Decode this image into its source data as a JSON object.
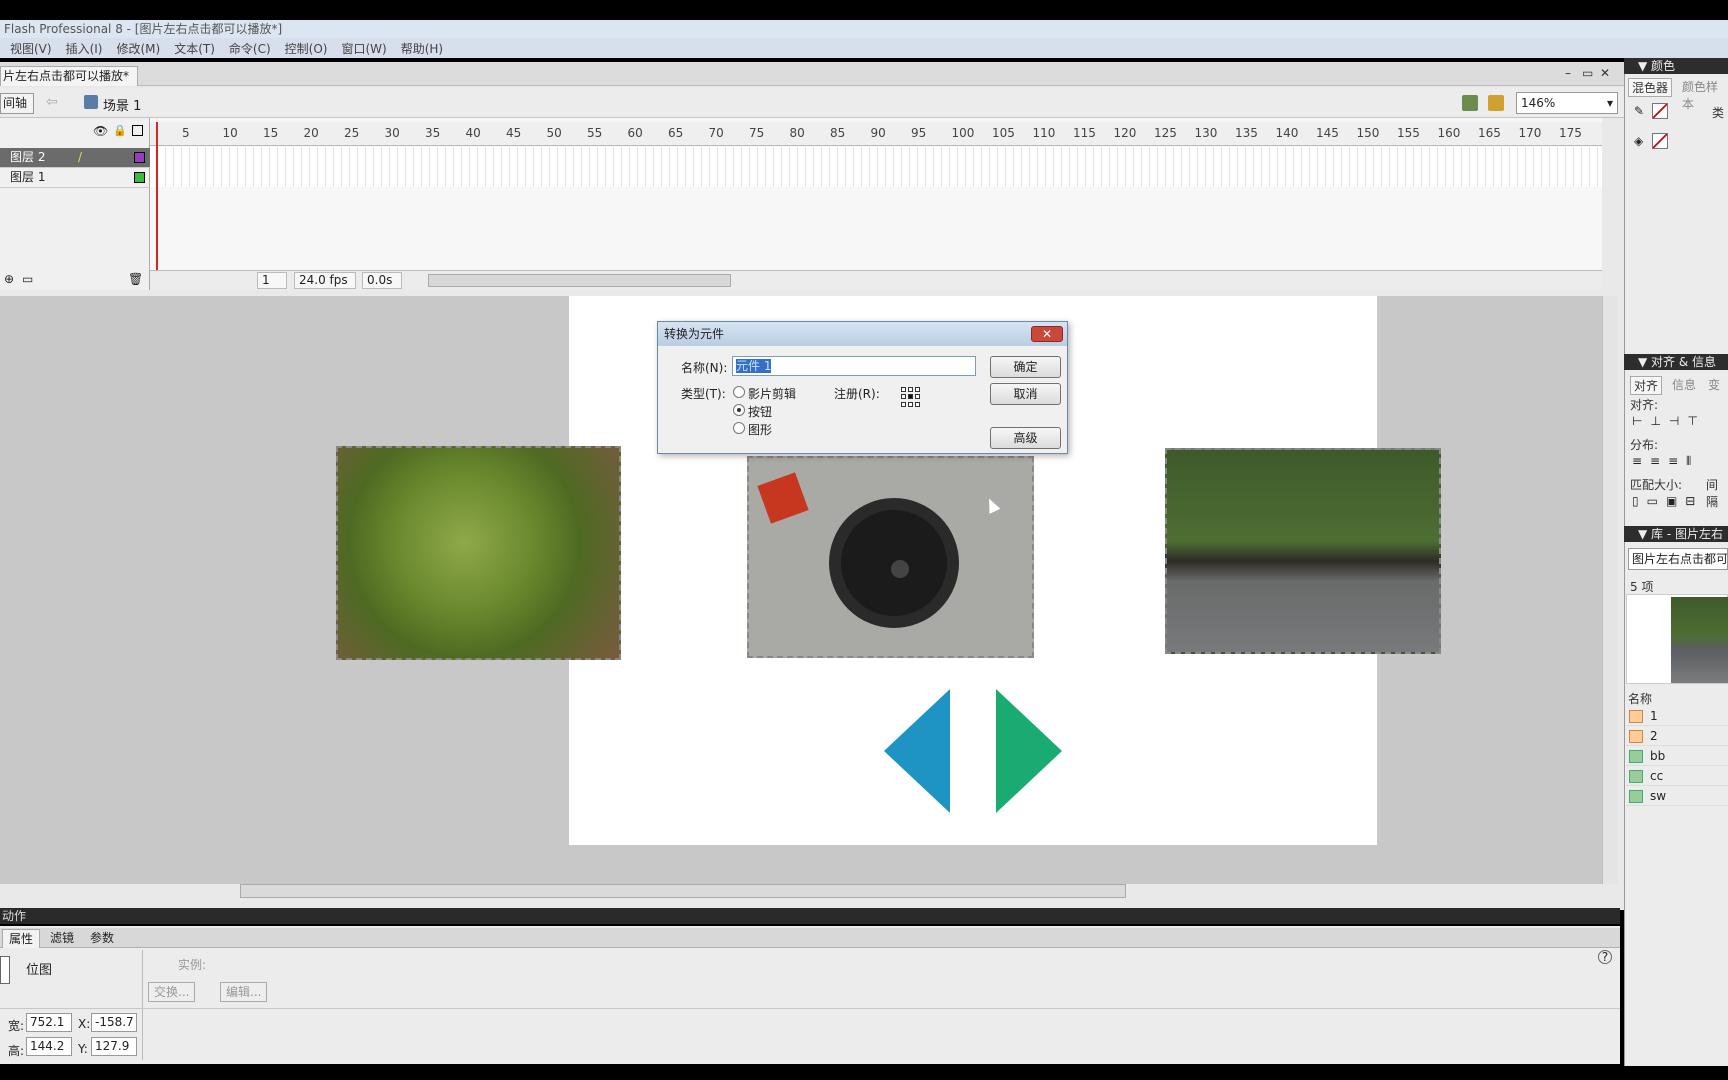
{
  "window": {
    "title": "Flash Professional 8 - [图片左右点击都可以播放*]"
  },
  "menu": [
    "视图(V)",
    "插入(I)",
    "修改(M)",
    "文本(T)",
    "命令(C)",
    "控制(O)",
    "窗口(W)",
    "帮助(H)"
  ],
  "document": {
    "tab": "片左右点击都可以播放*",
    "min": "–",
    "restore": "▭",
    "close": "✕"
  },
  "editbar": {
    "timeline_btn": "间轴",
    "back_arrow": "⇦",
    "scene": "场景 1",
    "zoom": "146%"
  },
  "timeline": {
    "layers": [
      {
        "name": "图层 2",
        "color": "#9a3bbd",
        "selected": true
      },
      {
        "name": "图层 1",
        "color": "#3bbd3b",
        "selected": false
      }
    ],
    "ruler_ticks": [
      "5",
      "10",
      "15",
      "20",
      "25",
      "30",
      "35",
      "40",
      "45",
      "50",
      "55",
      "60",
      "65",
      "70",
      "75",
      "80",
      "85",
      "90",
      "95",
      "100",
      "105",
      "110",
      "115",
      "120",
      "125",
      "130",
      "135",
      "140",
      "145",
      "150",
      "155",
      "160",
      "165",
      "170",
      "175"
    ],
    "current_frame": "1",
    "fps": "24.0 fps",
    "time": "0.0s"
  },
  "dialog": {
    "title": "转换为元件",
    "name_label": "名称(N):",
    "name_value": "元件 1",
    "type_label": "类型(T):",
    "types": [
      "影片剪辑",
      "按钮",
      "图形"
    ],
    "selected_type": "按钮",
    "reg_label": "注册(R):",
    "ok": "确定",
    "cancel": "取消",
    "advanced": "高级",
    "close_icon": "✕"
  },
  "actions_panel": {
    "title": "动作"
  },
  "properties": {
    "tabs": [
      "属性",
      "滤镜",
      "参数"
    ],
    "type": "位图",
    "instance_label": "实例:",
    "swap": "交换...",
    "edit": "编辑...",
    "width_label": "宽:",
    "width": "752.1",
    "height_label": "高:",
    "height": "144.2",
    "x_label": "X:",
    "x": "-158.7",
    "y_label": "Y:",
    "y": "127.9",
    "help": "?"
  },
  "right_panels": {
    "color_header": "▼ 颜色",
    "color_tabs": [
      "混色器",
      "颜色样本"
    ],
    "color_type": "类",
    "align_header": "▼ 对齐 & 信息 &",
    "align_tabs": [
      "对齐",
      "信息",
      "变"
    ],
    "align_label": "对齐:",
    "distribute_label": "分布:",
    "match_label": "匹配大小:",
    "spacing_label": "间隔",
    "library_header": "▼ 库 - 图片左右点",
    "library_select": "图片左右点击都可",
    "item_count": "5 项",
    "name_col": "名称",
    "items": [
      "1",
      "2",
      "bb",
      "cc",
      "sw"
    ]
  }
}
